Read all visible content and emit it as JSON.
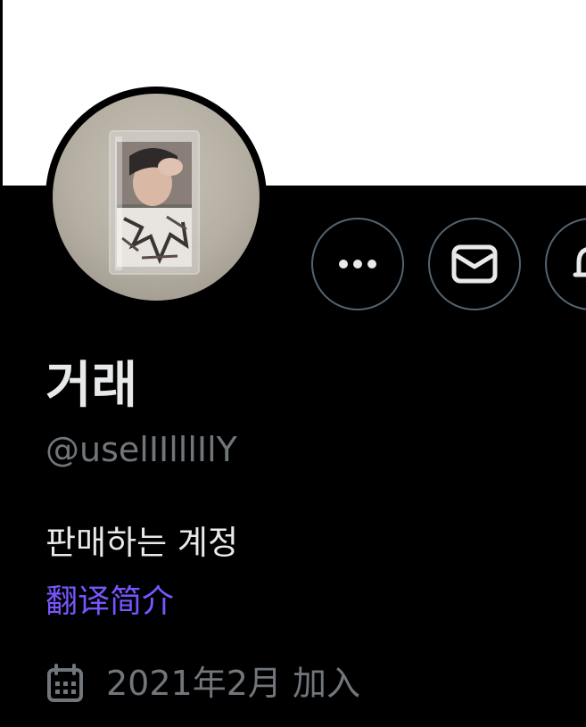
{
  "profile": {
    "display_name": "거래",
    "handle": "@uselIIlllIlY",
    "bio": "판매하는 계정",
    "translate_label": "翻译简介",
    "joined": "2021年2月 加入"
  },
  "actions": {
    "more_icon": "more-horizontal-icon",
    "message_icon": "envelope-icon",
    "notify_icon": "bell-plus-icon"
  },
  "colors": {
    "background": "#000000",
    "banner": "#ffffff",
    "primary_text": "#e7e9ea",
    "secondary_text": "#71767b",
    "accent_link": "#7856ff",
    "button_border": "#536471"
  }
}
